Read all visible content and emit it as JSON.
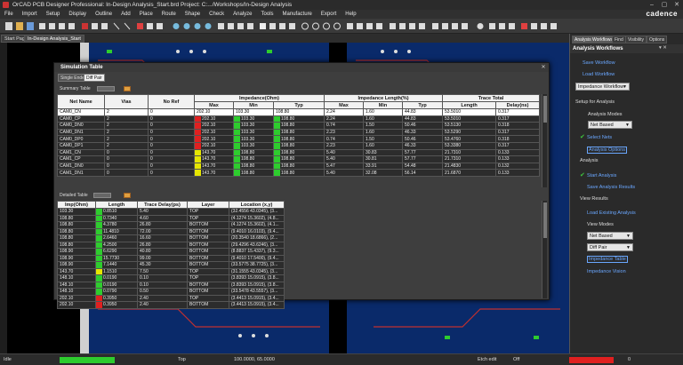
{
  "window": {
    "title": "OrCAD PCB Designer Professional: In-Design Analysis_Start.brd  Project: C:.../Workshops/In-Design Analysis",
    "brand": "cadence"
  },
  "menu": [
    "File",
    "Import",
    "Setup",
    "Display",
    "Outline",
    "Add",
    "Place",
    "Route",
    "Shape",
    "Check",
    "Analyze",
    "Tools",
    "Manufacture",
    "Export",
    "Help"
  ],
  "doc_tabs": [
    "Start Page",
    "In-Design Analysis_Start"
  ],
  "right_panel": {
    "tabs": [
      "Analysis Workflows",
      "Find",
      "Visibility",
      "Options"
    ],
    "header": "Analysis Workflows",
    "save_workflow": "Save Workflow",
    "load_workflow": "Load Workflow",
    "workflow_select": "Impedance Workflow",
    "setup_label": "Setup for Analysis",
    "analysis_modes_label": "Analysis Modes",
    "analysis_mode_value": "Net Based",
    "select_nets": "Select Nets",
    "analysis_options": "Analysis Options",
    "analysis_label": "Analysis",
    "start_analysis": "Start Analysis",
    "save_results": "Save Analysis Results",
    "view_results_label": "View Results",
    "load_existing": "Load Existing Analysis",
    "view_modes_label": "View Modes",
    "view_mode_value": "Net Based",
    "view_mode2_value": "Diff Pair",
    "impedance_table": "Impedance Table",
    "impedance_vision": "Impedance Vision"
  },
  "sim": {
    "title": "Simulation Table",
    "tabs": [
      "Single Ended",
      "Diff Pair"
    ],
    "summary_label": "Summary Table",
    "detailed_label": "Detailed Table",
    "summary_headers": {
      "net_name": "Net Name",
      "vias": "Vias",
      "no_ref": "No Ref",
      "impedance": "Impedance(Ohm)",
      "imp_length": "Impedance Length(%)",
      "trace_total": "Trace Total",
      "max": "Max",
      "min": "Min",
      "typ": "Typ",
      "max2": "Max",
      "min2": "Min",
      "typ2": "Typ",
      "length": "Length",
      "delay": "Delay(ns)"
    },
    "summary_rows": [
      {
        "net": "CAM0_CN",
        "vias": "2",
        "noref": "0",
        "max": "202.10",
        "min": "103.30",
        "typ": "108.80",
        "lmax": "2.24",
        "lmin": "1.60",
        "ltyp": "44.83",
        "len": "53.5010",
        "delay": "0.317",
        "fmax": "none",
        "fmin": "none",
        "ftyp": "none",
        "sel": true
      },
      {
        "net": "CAM0_CP",
        "vias": "2",
        "noref": "0",
        "max": "202.10",
        "min": "103.30",
        "typ": "108.80",
        "lmax": "2.24",
        "lmin": "1.60",
        "ltyp": "44.83",
        "len": "53.5010",
        "delay": "0.317",
        "fmax": "red",
        "fmin": "green",
        "ftyp": "green"
      },
      {
        "net": "CAM0_DN0",
        "vias": "2",
        "noref": "0",
        "max": "202.10",
        "min": "103.30",
        "typ": "108.80",
        "lmax": "0.74",
        "lmin": "1.50",
        "ltyp": "50.46",
        "len": "53.5130",
        "delay": "0.318",
        "fmax": "red",
        "fmin": "green",
        "ftyp": "green"
      },
      {
        "net": "CAM0_DN1",
        "vias": "2",
        "noref": "0",
        "max": "202.10",
        "min": "103.30",
        "typ": "108.80",
        "lmax": "2.23",
        "lmin": "1.60",
        "ltyp": "46.33",
        "len": "53.5290",
        "delay": "0.317",
        "fmax": "red",
        "fmin": "green",
        "ftyp": "green"
      },
      {
        "net": "CAM0_DP0",
        "vias": "2",
        "noref": "0",
        "max": "202.10",
        "min": "103.30",
        "typ": "108.80",
        "lmax": "0.74",
        "lmin": "1.50",
        "ltyp": "50.46",
        "len": "53.4760",
        "delay": "0.318",
        "fmax": "red",
        "fmin": "green",
        "ftyp": "green"
      },
      {
        "net": "CAM0_DP1",
        "vias": "2",
        "noref": "0",
        "max": "202.10",
        "min": "103.30",
        "typ": "108.80",
        "lmax": "2.23",
        "lmin": "1.60",
        "ltyp": "46.33",
        "len": "53.3380",
        "delay": "0.317",
        "fmax": "red",
        "fmin": "green",
        "ftyp": "green"
      },
      {
        "net": "CAM1_CN",
        "vias": "0",
        "noref": "0",
        "max": "143.70",
        "min": "108.80",
        "typ": "108.80",
        "lmax": "5.40",
        "lmin": "30.83",
        "ltyp": "57.77",
        "len": "21.7310",
        "delay": "0.133",
        "fmax": "yellow",
        "fmin": "green",
        "ftyp": "green"
      },
      {
        "net": "CAM1_CP",
        "vias": "0",
        "noref": "0",
        "max": "143.70",
        "min": "108.80",
        "typ": "108.80",
        "lmax": "5.40",
        "lmin": "30.81",
        "ltyp": "57.77",
        "len": "21.7310",
        "delay": "0.133",
        "fmax": "yellow",
        "fmin": "green",
        "ftyp": "green"
      },
      {
        "net": "CAM1_DN0",
        "vias": "0",
        "noref": "0",
        "max": "143.70",
        "min": "108.80",
        "typ": "108.80",
        "lmax": "5.47",
        "lmin": "33.91",
        "ltyp": "54.48",
        "len": "21.4830",
        "delay": "0.132",
        "fmax": "yellow",
        "fmin": "green",
        "ftyp": "green"
      },
      {
        "net": "CAM1_DN1",
        "vias": "0",
        "noref": "0",
        "max": "143.70",
        "min": "108.80",
        "typ": "108.80",
        "lmax": "5.40",
        "lmin": "32.08",
        "ltyp": "56.14",
        "len": "21.6870",
        "delay": "0.133",
        "fmax": "yellow",
        "fmin": "green",
        "ftyp": "green"
      }
    ],
    "detail_headers": {
      "imp": "Imp(Ohm)",
      "len": "Length",
      "delay": "Trace Delay(ps)",
      "layer": "Layer",
      "loc": "Location (x,y)"
    },
    "detail_rows": [
      {
        "imp": "103.30",
        "len": "0.8510",
        "delay": "5.40",
        "layer": "TOP",
        "loc": "(32.4556 43.0345), (3...",
        "f": "green"
      },
      {
        "imp": "108.80",
        "len": "0.7340",
        "delay": "4.60",
        "layer": "TOP",
        "loc": "(4.1274 15.3602), (4.8...",
        "f": "green"
      },
      {
        "imp": "108.80",
        "len": "4.3780",
        "delay": "26.80",
        "layer": "BOTTOM",
        "loc": "(4.1274 15.3602), (4.1...",
        "f": "green"
      },
      {
        "imp": "108.80",
        "len": "11.4810",
        "delay": "72.00",
        "layer": "BOTTOM",
        "loc": "(9.4010 16.0103), (9.4...",
        "f": "green"
      },
      {
        "imp": "108.80",
        "len": "2.6460",
        "delay": "16.60",
        "layer": "BOTTOM",
        "loc": "(20.3540 18.6866), (2...",
        "f": "green"
      },
      {
        "imp": "108.80",
        "len": "4.2500",
        "delay": "26.80",
        "layer": "BOTTOM",
        "loc": "(29.4296 43.6246), (3...",
        "f": "green"
      },
      {
        "imp": "108.90",
        "len": "6.6290",
        "delay": "40.80",
        "layer": "BOTTOM",
        "loc": "(8.8837 15.4337), (9.3...",
        "f": "green"
      },
      {
        "imp": "108.90",
        "len": "15.7730",
        "delay": "99.00",
        "layer": "BOTTOM",
        "loc": "(9.4010 17.5400), (9.4...",
        "f": "green"
      },
      {
        "imp": "108.90",
        "len": "7.1440",
        "delay": "45.30",
        "layer": "BOTTOM",
        "loc": "(33.5775 38.7725), (3...",
        "f": "green"
      },
      {
        "imp": "143.70",
        "len": "1.1510",
        "delay": "7.50",
        "layer": "TOP",
        "loc": "(31.1555 43.0345), (3...",
        "f": "yellow"
      },
      {
        "imp": "148.10",
        "len": "0.0190",
        "delay": "0.10",
        "layer": "TOP",
        "loc": "(3.8393 15.0915), (3.8...",
        "f": "green"
      },
      {
        "imp": "148.10",
        "len": "0.0190",
        "delay": "0.10",
        "layer": "BOTTOM",
        "loc": "(3.8393 15.0915), (3.8...",
        "f": "green"
      },
      {
        "imp": "148.10",
        "len": "0.0790",
        "delay": "0.50",
        "layer": "BOTTOM",
        "loc": "(33.5478 43.5557), (3...",
        "f": "green"
      },
      {
        "imp": "202.10",
        "len": "0.3950",
        "delay": "2.40",
        "layer": "TOP",
        "loc": "(3.4413 15.0915), (3.4...",
        "f": "red"
      },
      {
        "imp": "202.10",
        "len": "0.3950",
        "delay": "2.40",
        "layer": "BOTTOM",
        "loc": "(3.4413 15.0915), (3.4...",
        "f": "red"
      }
    ]
  },
  "status": {
    "mode": "Idle",
    "layer": "Top",
    "coords": "100.0000, 65.0000",
    "edit": "Etch edit",
    "off": "Off",
    "zero": "0"
  },
  "colors": {
    "flag_green": "#2ecc2e",
    "flag_red": "#e02020",
    "flag_yellow": "#e6e600",
    "link": "#6aa7ff"
  }
}
